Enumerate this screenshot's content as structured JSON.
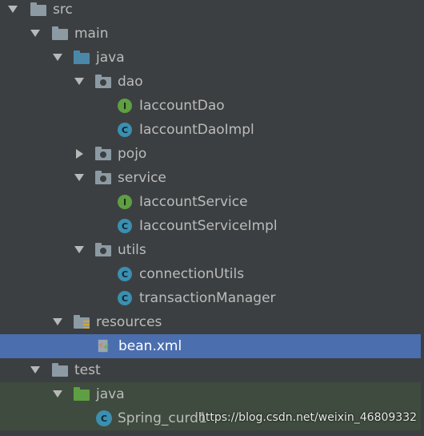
{
  "tree": [
    {
      "label": "src",
      "icon": "folder-icon"
    },
    {
      "label": "main",
      "icon": "folder-icon"
    },
    {
      "label": "java",
      "icon": "source-folder-icon"
    },
    {
      "label": "dao",
      "icon": "package-icon"
    },
    {
      "label": "IaccountDao",
      "icon": "interface-icon",
      "badge": "I"
    },
    {
      "label": "IaccountDaoImpl",
      "icon": "class-icon",
      "badge": "C"
    },
    {
      "label": "pojo",
      "icon": "package-icon"
    },
    {
      "label": "service",
      "icon": "package-icon"
    },
    {
      "label": "IaccountService",
      "icon": "interface-icon",
      "badge": "I"
    },
    {
      "label": "IaccountServiceImpl",
      "icon": "class-icon",
      "badge": "C"
    },
    {
      "label": "utils",
      "icon": "package-icon"
    },
    {
      "label": "connectionUtils",
      "icon": "class-icon",
      "badge": "C"
    },
    {
      "label": "transactionManager",
      "icon": "class-icon",
      "badge": "C"
    },
    {
      "label": "resources",
      "icon": "resources-folder-icon"
    },
    {
      "label": "bean.xml",
      "icon": "xml-file-icon"
    },
    {
      "label": "test",
      "icon": "folder-icon"
    },
    {
      "label": "java",
      "icon": "test-source-folder-icon"
    },
    {
      "label": "Spring_curd1",
      "icon": "spring-class-icon",
      "badge": "C"
    }
  ],
  "watermark": "https://blog.csdn.net/weixin_46809332",
  "colors": {
    "background": "#3c3f41",
    "selection": "#4b6eaf",
    "text": "#bbbbbb"
  }
}
